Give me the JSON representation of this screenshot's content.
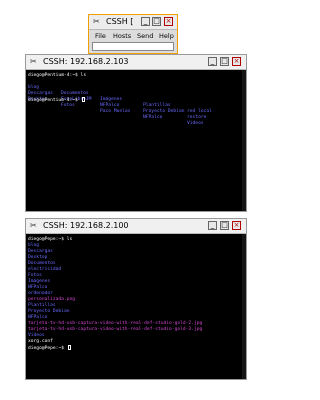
{
  "small_window": {
    "title": "CSSH [",
    "menu": [
      "File",
      "Hosts",
      "Send",
      "Help"
    ]
  },
  "terminal1": {
    "title": "CSSH: 192.168.2.103",
    "prompt1": "diego@Pentium-4:~$ ls",
    "ls_rows": [
      [
        "blog",
        "Documentos",
        "Imágenes",
        "Plantillas",
        "red local"
      ],
      [
        "Descargas",
        "FotoLibroJM",
        "NFPalco",
        "Proyecto Debian",
        "restore"
      ],
      [
        "Desktop",
        "Fotos",
        "Paco Muelas",
        "NFPalco",
        "Videos"
      ]
    ],
    "prompt2": "diego@Pentium-4:~$"
  },
  "terminal2": {
    "title": "CSSH: 192.168.2.100",
    "prompt1": "diego@Pepe:~$ ls",
    "items": [
      {
        "text": "blog",
        "color": "blue"
      },
      {
        "text": "Descargas",
        "color": "blue"
      },
      {
        "text": "Desktop",
        "color": "blue"
      },
      {
        "text": "Documentos",
        "color": "blue"
      },
      {
        "text": "electricidad",
        "color": "blue"
      },
      {
        "text": "Fotos",
        "color": "blue"
      },
      {
        "text": "Imágenes",
        "color": "blue"
      },
      {
        "text": "NFPalco",
        "color": "blue"
      },
      {
        "text": "ordenador",
        "color": "blue"
      },
      {
        "text": "personalizada.png",
        "color": "pink"
      },
      {
        "text": "Plantillas",
        "color": "blue"
      },
      {
        "text": "Proyecto Debian",
        "color": "blue"
      },
      {
        "text": "NFPalco",
        "color": "blue"
      },
      {
        "text": "tarjeta-tv-hd-usb-captura-video-with-real-def-studio-gold-2.jpg",
        "color": "pink"
      },
      {
        "text": "tarjeta-tv-hd-usb-captura-video-with-real-def-studio-gold-3.jpg",
        "color": "pink"
      },
      {
        "text": "Videos",
        "color": "blue"
      },
      {
        "text": "xorg.conf",
        "color": "white"
      }
    ],
    "prompt2": "diego@Pepe:~$"
  }
}
